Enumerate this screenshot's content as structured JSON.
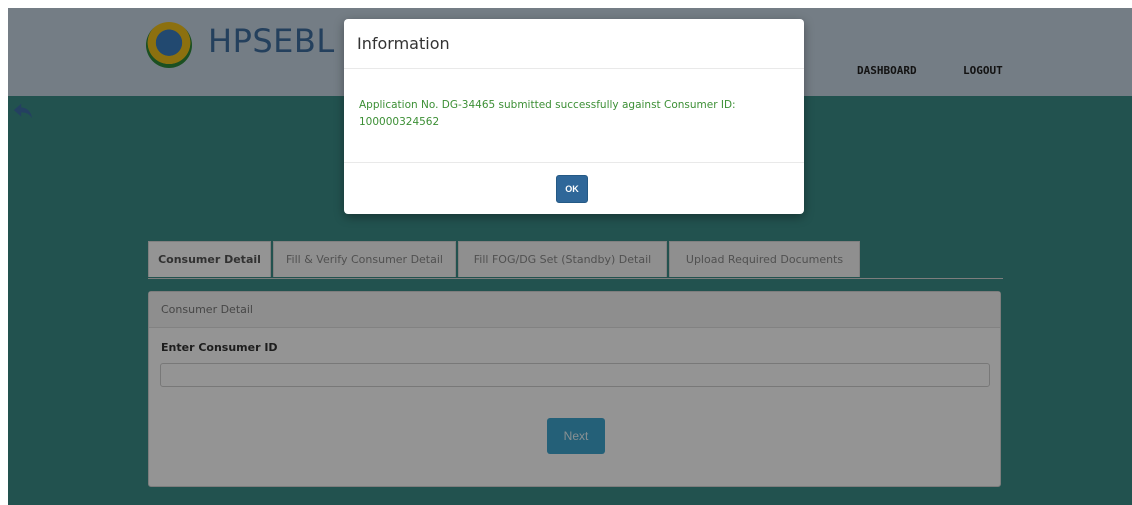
{
  "header": {
    "brand": "HPSEBL",
    "nav": {
      "dashboard": "DASHBOARD",
      "logout": "LOGOUT"
    }
  },
  "tabs": [
    {
      "label": "Consumer Detail",
      "active": true
    },
    {
      "label": "Fill & Verify Consumer Detail",
      "active": false
    },
    {
      "label": "Fill FOG/DG Set (Standby) Detail",
      "active": false
    },
    {
      "label": "Upload Required Documents",
      "active": false
    }
  ],
  "card": {
    "header": "Consumer Detail",
    "field_label": "Enter Consumer ID",
    "field_value": "",
    "next_label": "Next"
  },
  "modal": {
    "title": "Information",
    "message": "Application No. DG-34465 submitted successfully against Consumer ID: 100000324562",
    "ok_label": "OK"
  },
  "icons": {
    "back": "back-arrow-icon",
    "logo": "logo-icon"
  },
  "colors": {
    "header_bg": "#c9d7e5",
    "main_bg": "#3b8d88",
    "modal_message": "#3c8f35",
    "ok_button": "#2f6799",
    "next_button": "#3ea6cf"
  }
}
